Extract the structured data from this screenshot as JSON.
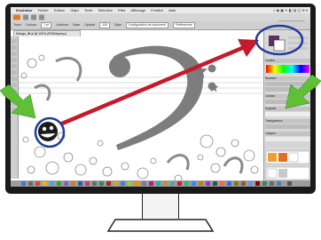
{
  "app": {
    "name": "Illustrator",
    "menus": [
      "Fichier",
      "Edition",
      "Objet",
      "Texte",
      "Sélection",
      "Effet",
      "Affichage",
      "Fenêtre",
      "Aide"
    ],
    "workspace": "Les Essentiels"
  },
  "toolbar": {
    "controls": [
      "Tracé",
      "Contour",
      "1 pt",
      "Uniforme",
      "Base",
      "Opacité",
      "100",
      "Style",
      "Configuration de document",
      "Préférences"
    ]
  },
  "document": {
    "tab_label": "Design_fill.ai @ 100% (RVB/Aperçu)"
  },
  "panels": {
    "headers": [
      "Couleur",
      "Nuancier",
      "Contour",
      "Dégradé",
      "Transparence",
      "Calques"
    ]
  },
  "colors": {
    "accent_arrow": "#c41a2b",
    "highlight_circle": "#1f3f9a",
    "pointer_arrow": "#5fbf35",
    "bezel": "#1a1a1a"
  },
  "icons": [
    "apple-logo-icon",
    "bass-clef-icon",
    "star-icon",
    "bubble-icon",
    "smiley-character-icon",
    "red-arrow-icon",
    "green-arrow-icon"
  ]
}
